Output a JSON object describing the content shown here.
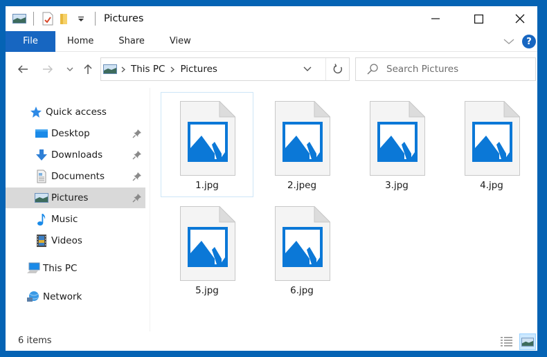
{
  "window": {
    "title": "Pictures",
    "controls": {
      "minimize": "minimize",
      "maximize": "maximize",
      "close": "close"
    }
  },
  "quick_access_toolbar": {
    "icons": [
      "pictures-folder-icon",
      "properties-icon",
      "new-folder-icon",
      "customize-dropdown-icon"
    ]
  },
  "ribbon": {
    "tabs": [
      {
        "label": "File",
        "active": true
      },
      {
        "label": "Home"
      },
      {
        "label": "Share"
      },
      {
        "label": "View"
      }
    ],
    "help_label": "?"
  },
  "address_bar": {
    "breadcrumbs": [
      "This PC",
      "Pictures"
    ]
  },
  "search": {
    "placeholder": "Search Pictures"
  },
  "navigation_pane": {
    "items": [
      {
        "label": "Quick access",
        "icon": "star-icon",
        "level": 0,
        "pinned": false
      },
      {
        "label": "Desktop",
        "icon": "desktop-icon",
        "level": 1,
        "pinned": true
      },
      {
        "label": "Downloads",
        "icon": "downloads-icon",
        "level": 1,
        "pinned": true
      },
      {
        "label": "Documents",
        "icon": "documents-icon",
        "level": 1,
        "pinned": true
      },
      {
        "label": "Pictures",
        "icon": "pictures-icon",
        "level": 1,
        "pinned": true,
        "selected": true
      },
      {
        "label": "Music",
        "icon": "music-icon",
        "level": 1,
        "pinned": false
      },
      {
        "label": "Videos",
        "icon": "videos-icon",
        "level": 1,
        "pinned": false
      },
      {
        "label": "This PC",
        "icon": "computer-icon",
        "level": 0,
        "pinned": false
      },
      {
        "label": "Network",
        "icon": "network-icon",
        "level": 0,
        "pinned": false
      }
    ]
  },
  "files": [
    {
      "name": "1.jpg",
      "selected": true
    },
    {
      "name": "2.jpeg"
    },
    {
      "name": "3.jpg"
    },
    {
      "name": "4.jpg"
    },
    {
      "name": "5.jpg"
    },
    {
      "name": "6.jpg"
    }
  ],
  "status_bar": {
    "item_count": "6 items"
  },
  "colors": {
    "accent": "#1766c1",
    "frame": "#0563b4",
    "image_icon_blue": "#0b78d7",
    "selection": "#d9d9d9"
  }
}
